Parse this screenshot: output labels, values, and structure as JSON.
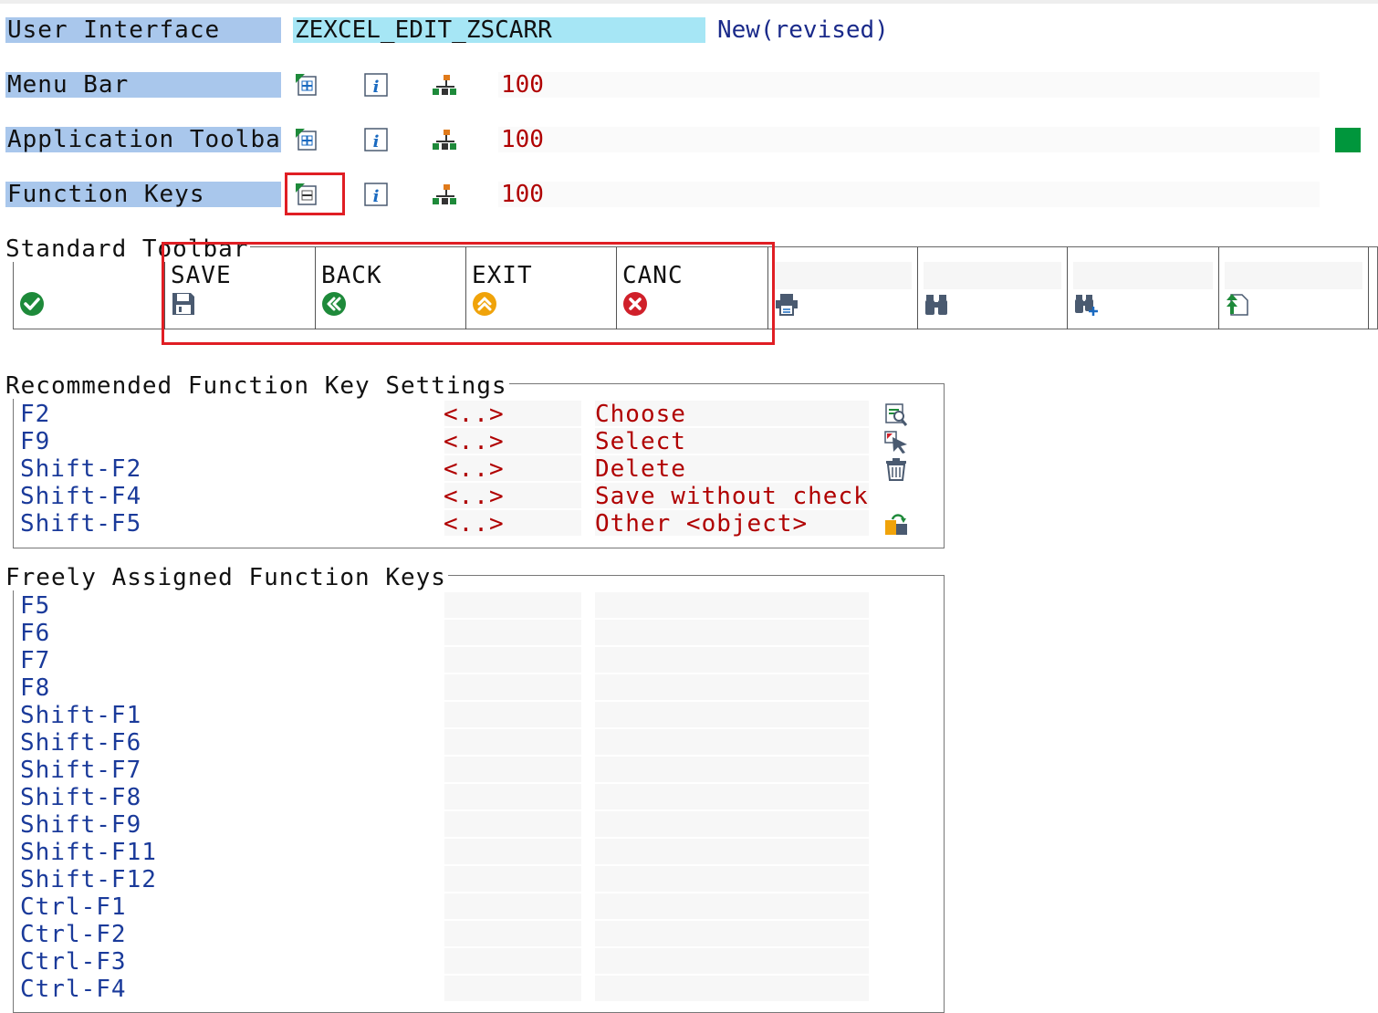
{
  "header": {
    "ui_label": "User Interface",
    "ui_name": "ZEXCEL_EDIT_ZSCARR",
    "status": "New(revised)"
  },
  "rows": [
    {
      "label": "Menu Bar",
      "value": "100"
    },
    {
      "label": "Application Toolbar",
      "value": "100"
    },
    {
      "label": "Function Keys",
      "value": "100"
    }
  ],
  "standard_toolbar": {
    "title": "Standard Toolbar",
    "buttons": [
      {
        "code": "",
        "icon": "check-icon"
      },
      {
        "code": "SAVE",
        "icon": "save-icon"
      },
      {
        "code": "BACK",
        "icon": "back-icon"
      },
      {
        "code": "EXIT",
        "icon": "exit-icon"
      },
      {
        "code": "CANC",
        "icon": "cancel-icon"
      },
      {
        "code": "",
        "icon": "print-icon"
      },
      {
        "code": "",
        "icon": "find-icon"
      },
      {
        "code": "",
        "icon": "find-next-icon"
      },
      {
        "code": "",
        "icon": "first-page-icon"
      }
    ]
  },
  "recommended": {
    "title": "Recommended Function Key Settings",
    "rows": [
      {
        "key": "F2",
        "code": "<..>",
        "text": "Choose",
        "icon": "choose-icon"
      },
      {
        "key": "F9",
        "code": "<..>",
        "text": "Select",
        "icon": "select-icon"
      },
      {
        "key": "Shift-F2",
        "code": "<..>",
        "text": "Delete",
        "icon": "delete-icon"
      },
      {
        "key": "Shift-F4",
        "code": "<..>",
        "text": "Save without check",
        "icon": ""
      },
      {
        "key": "Shift-F5",
        "code": "<..>",
        "text": "Other <object>",
        "icon": "other-object-icon"
      }
    ]
  },
  "freely": {
    "title": "Freely Assigned Function Keys",
    "keys": [
      "F5",
      "F6",
      "F7",
      "F8",
      "Shift-F1",
      "Shift-F6",
      "Shift-F7",
      "Shift-F8",
      "Shift-F9",
      "Shift-F11",
      "Shift-F12",
      "Ctrl-F1",
      "Ctrl-F2",
      "Ctrl-F3",
      "Ctrl-F4"
    ]
  },
  "colors": {
    "label_bg": "#a9c7ec",
    "name_bg": "#a6e6f5",
    "key_text": "#1a3a9a",
    "func_text": "#b00000",
    "highlight": "#e01e24"
  }
}
